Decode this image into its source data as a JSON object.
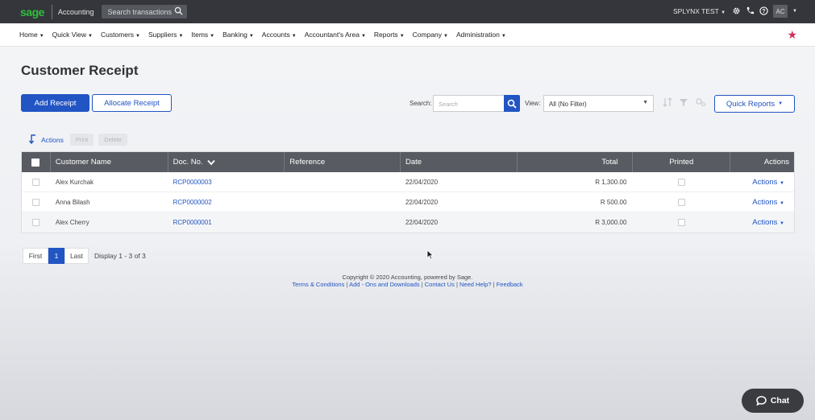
{
  "topbar": {
    "logo": "sage",
    "app_name": "Accounting",
    "search_placeholder": "Search transactions",
    "company": "SPLYNX TEST",
    "user_initials": "AC",
    "icons": [
      "gear-icon",
      "phone-icon",
      "help-icon"
    ]
  },
  "menu": {
    "items": [
      {
        "label": "Home"
      },
      {
        "label": "Quick View"
      },
      {
        "label": "Customers"
      },
      {
        "label": "Suppliers"
      },
      {
        "label": "Items"
      },
      {
        "label": "Banking"
      },
      {
        "label": "Accounts"
      },
      {
        "label": "Accountant's Area"
      },
      {
        "label": "Reports"
      },
      {
        "label": "Company"
      },
      {
        "label": "Administration"
      }
    ]
  },
  "page": {
    "title": "Customer Receipt",
    "add_button": "Add Receipt",
    "allocate_button": "Allocate Receipt",
    "search_label": "Search:",
    "search_placeholder": "Search",
    "view_label": "View:",
    "view_value": "All (No Filter)",
    "quick_reports": "Quick Reports"
  },
  "actions_bar": {
    "actions": "Actions",
    "print": "Print",
    "delete": "Delete"
  },
  "table": {
    "headers": {
      "customer_name": "Customer Name",
      "doc_no": "Doc. No.",
      "reference": "Reference",
      "date": "Date",
      "total": "Total",
      "printed": "Printed",
      "actions": "Actions"
    },
    "rows": [
      {
        "customer": "Alex Kurchak",
        "doc": "RCP0000003",
        "reference": "",
        "date": "22/04/2020",
        "total": "R 1,300.00",
        "printed": false,
        "actions": "Actions"
      },
      {
        "customer": "Anna Bilash",
        "doc": "RCP0000002",
        "reference": "",
        "date": "22/04/2020",
        "total": "R 500.00",
        "printed": false,
        "actions": "Actions"
      },
      {
        "customer": "Alex Cherry",
        "doc": "RCP0000001",
        "reference": "",
        "date": "22/04/2020",
        "total": "R 3,000.00",
        "printed": false,
        "actions": "Actions"
      }
    ]
  },
  "pagination": {
    "first": "First",
    "current": "1",
    "last": "Last",
    "info": "Display 1 - 3 of 3"
  },
  "footer": {
    "copyright": "Copyright © 2020 Accounting, powered by Sage.",
    "links": [
      "Terms & Conditions",
      "Add - Ons and Downloads",
      "Contact Us",
      "Need Help?",
      "Feedback"
    ]
  },
  "chat": {
    "label": "Chat"
  },
  "colors": {
    "primary": "#2255c4",
    "topbar": "#34363b",
    "brand_green": "#2fbf3b",
    "table_header": "#585b61",
    "favorite": "#d0315c"
  }
}
